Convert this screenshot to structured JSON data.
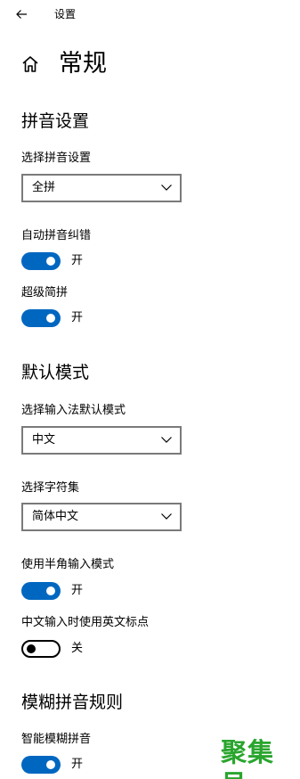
{
  "titlebar": {
    "title": "设置"
  },
  "header": {
    "title": "常规"
  },
  "pinyin_section": {
    "title": "拼音设置",
    "select_label": "选择拼音设置",
    "select_value": "全拼",
    "auto_correct_label": "自动拼音纠错",
    "auto_correct_state": "开",
    "super_abbrev_label": "超级简拼",
    "super_abbrev_state": "开"
  },
  "default_mode_section": {
    "title": "默认模式",
    "mode_label": "选择输入法默认模式",
    "mode_value": "中文",
    "charset_label": "选择字符集",
    "charset_value": "简体中文",
    "halfwidth_label": "使用半角输入模式",
    "halfwidth_state": "开",
    "english_punct_label": "中文输入时使用英文标点",
    "english_punct_state": "关"
  },
  "fuzzy_section": {
    "title": "模糊拼音规则",
    "smart_fuzzy_label": "智能模糊拼音",
    "smart_fuzzy_state": "开"
  },
  "watermark": "聚集号",
  "colors": {
    "accent": "#0067c0",
    "watermark": "#2aa52e",
    "dropdown_border": "#7a7a7a"
  },
  "icons": [
    "back-arrow-icon",
    "home-icon",
    "chevron-down-icon"
  ]
}
